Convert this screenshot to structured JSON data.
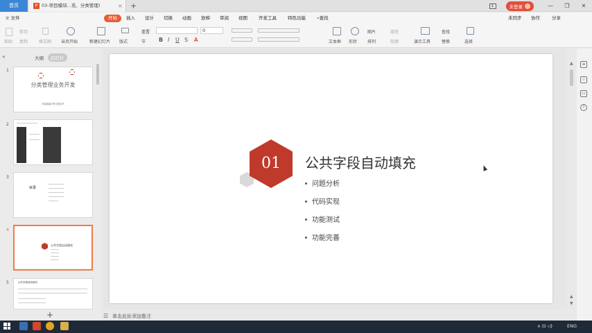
{
  "titlebar": {
    "home_tab": "首页",
    "doc_tab_title": "03-项目模块...充、分类管理)",
    "doc_tab_close": "×",
    "new_tab": "+",
    "login_label": "未登录",
    "page_icon_label": "1",
    "minimize": "—",
    "restore": "❐",
    "close": "✕"
  },
  "menubar": {
    "file": "≡ 文件",
    "items": [
      "开始",
      "插入",
      "设计",
      "切换",
      "动画",
      "放映",
      "审阅",
      "视图",
      "开发工具",
      "特色功能"
    ],
    "search": "查找",
    "sync": "未同步",
    "collab": "协作",
    "share": "分享"
  },
  "ribbon": {
    "paste": "粘贴",
    "cut": "剪切",
    "copy": "复制",
    "format_painter": "格式刷",
    "from_start": "当页开始",
    "new_slide": "新建幻灯片",
    "layout": "版式",
    "section": "节",
    "reset": "重置",
    "font_size": "0",
    "textbox": "文本框",
    "shape": "形状",
    "arrange": "排列",
    "picture": "图片",
    "fill": "填充",
    "outline": "轮廓",
    "replace": "替换",
    "presenter_tools": "演示工具",
    "select": "选择",
    "find": "查找"
  },
  "panel": {
    "outline_tab": "大纲",
    "slides_tab": "幻灯片",
    "collapse_icon": "«",
    "add_slide": "+",
    "thumbnails": [
      {
        "num": "1",
        "title": "分类管理业务开发",
        "subtitle": "传智播客·黑马程序员"
      },
      {
        "num": "2"
      },
      {
        "num": "3",
        "heading": "目录"
      },
      {
        "num": "4",
        "heading": "公共字段自动填充"
      },
      {
        "num": "5",
        "heading": "公共字段自动填充"
      }
    ]
  },
  "slide": {
    "number": "01",
    "title": "公共字段自动填充",
    "bullets": [
      "问题分析",
      "代码实现",
      "功能测试",
      "功能完善"
    ]
  },
  "notes": {
    "placeholder": "单击此处添加备注"
  },
  "taskbar": {
    "time": "ENG",
    "tray": "∧  ⊡  ◁)"
  },
  "colors": {
    "accent": "#e85c37",
    "hexagon": "#c03a2b",
    "home_tab": "#3c86d6",
    "taskbar": "#1f2a38"
  }
}
